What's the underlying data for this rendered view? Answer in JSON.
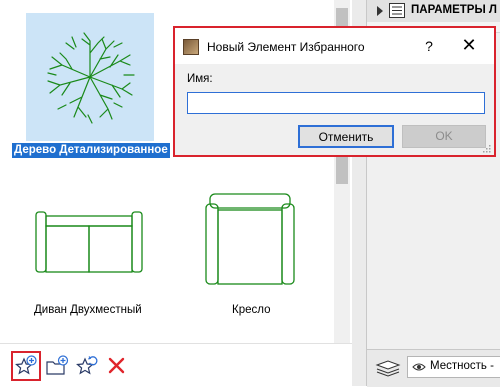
{
  "favorites": {
    "items": [
      {
        "label": "Дерево Детализированное",
        "icon": "tree-plan-icon",
        "selected": true
      },
      {
        "label": "Диван Двухместный",
        "icon": "sofa-plan-icon",
        "selected": false
      },
      {
        "label": "Кресло",
        "icon": "armchair-plan-icon",
        "selected": false
      }
    ],
    "toolbar": [
      {
        "name": "new-favorite-button",
        "icon": "star-plus-icon"
      },
      {
        "name": "new-folder-button",
        "icon": "folder-plus-icon"
      },
      {
        "name": "redefine-favorite-button",
        "icon": "star-refresh-icon"
      },
      {
        "name": "delete-favorite-button",
        "icon": "red-x-icon"
      }
    ]
  },
  "right_panel": {
    "header_title": "ПАРАМЕТРЫ Л",
    "layer_value": "Местность -"
  },
  "dialog": {
    "title": "Новый Элемент Избранного",
    "help": "?",
    "close": "✕",
    "name_label": "Имя:",
    "name_value": "",
    "cancel_label": "Отменить",
    "ok_label": "OK",
    "ok_enabled": false
  },
  "colors": {
    "selection_bg": "#cce4f7",
    "selection_label_bg": "#1f6fcf",
    "highlight_outline": "#d9232d",
    "plan_green": "#1a8a1a",
    "accent_blue": "#2e6fd6"
  }
}
